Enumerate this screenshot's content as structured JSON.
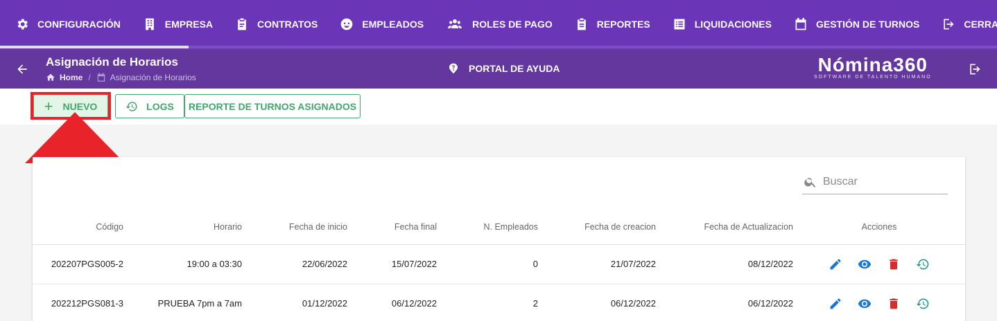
{
  "nav": {
    "items": [
      {
        "label": "CONFIGURACIÓN",
        "icon": "gear-icon"
      },
      {
        "label": "EMPRESA",
        "icon": "building-icon"
      },
      {
        "label": "CONTRATOS",
        "icon": "clipboard-icon"
      },
      {
        "label": "EMPLEADOS",
        "icon": "employee-icon"
      },
      {
        "label": "ROLES DE PAGO",
        "icon": "users-icon"
      },
      {
        "label": "REPORTES",
        "icon": "report-icon"
      },
      {
        "label": "LIQUIDACIONES",
        "icon": "list-icon"
      },
      {
        "label": "GESTIÓN DE TURNOS",
        "icon": "calendar-icon"
      },
      {
        "label": "CERRAR SESIÓN",
        "icon": "logout-icon"
      }
    ]
  },
  "header": {
    "title": "Asignación de Horarios",
    "breadcrumb_home": "Home",
    "breadcrumb_current": "Asignación de Horarios",
    "help_label": "PORTAL DE AYUDA",
    "brand_name": "Nómina360",
    "brand_tagline": "SOFTWARE DE TALENTO HUMANO"
  },
  "toolbar": {
    "new_label": "NUEVO",
    "logs_label": "LOGS",
    "report_label": "REPORTE DE TURNOS ASIGNADOS"
  },
  "search": {
    "placeholder": "Buscar"
  },
  "table": {
    "headers": [
      "Código",
      "Horario",
      "Fecha de inicio",
      "Fecha final",
      "N. Empleados",
      "Fecha de creacion",
      "Fecha de Actualizacion",
      "Acciones"
    ],
    "rows": [
      {
        "codigo": "202207PGS005-2",
        "horario": "19:00 a 03:30",
        "inicio": "22/06/2022",
        "final": "15/07/2022",
        "empleados": "0",
        "creacion": "21/07/2022",
        "actualizacion": "08/12/2022"
      },
      {
        "codigo": "202212PGS081-3",
        "horario": "PRUEBA 7pm a 7am",
        "inicio": "01/12/2022",
        "final": "06/12/2022",
        "empleados": "2",
        "creacion": "06/12/2022",
        "actualizacion": "06/12/2022"
      }
    ]
  },
  "colors": {
    "nav_bg": "#6a35b7",
    "subheader_bg": "#63379d",
    "accent_green": "#43a66a",
    "highlight_red": "#e8232a",
    "edit_blue": "#1976d2",
    "delete_red": "#d32f2f",
    "history_teal": "#2e9c8a"
  }
}
